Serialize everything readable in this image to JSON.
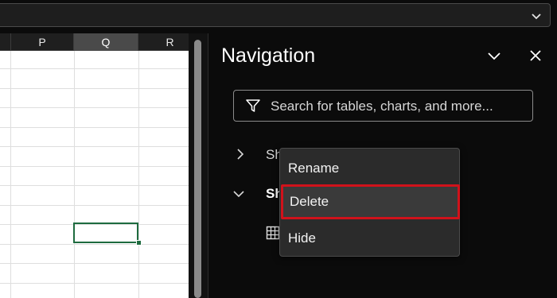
{
  "spreadsheet": {
    "columns": [
      {
        "label": "P",
        "selected": false
      },
      {
        "label": "Q",
        "selected": true
      },
      {
        "label": "R",
        "selected": false
      }
    ]
  },
  "navigation": {
    "title": "Navigation",
    "search_placeholder": "Search for tables, charts, and more...",
    "tree": [
      {
        "label": "Sh",
        "expanded": false,
        "bold": false
      },
      {
        "label": "Sh",
        "expanded": true,
        "bold": true
      }
    ]
  },
  "context_menu": {
    "items": [
      {
        "label": "Rename",
        "highlighted": false
      },
      {
        "label": "Delete",
        "highlighted": true
      },
      {
        "label": "Hide",
        "highlighted": false
      }
    ]
  },
  "colors": {
    "accent_cell": "#1e6b3f",
    "highlight_outline": "#d0121b",
    "menu_bg": "#2b2b2b"
  },
  "icons": [
    "chevron-down-icon",
    "collapse-chevron-icon",
    "close-icon",
    "filter-icon",
    "chevron-right-icon",
    "table-icon"
  ]
}
